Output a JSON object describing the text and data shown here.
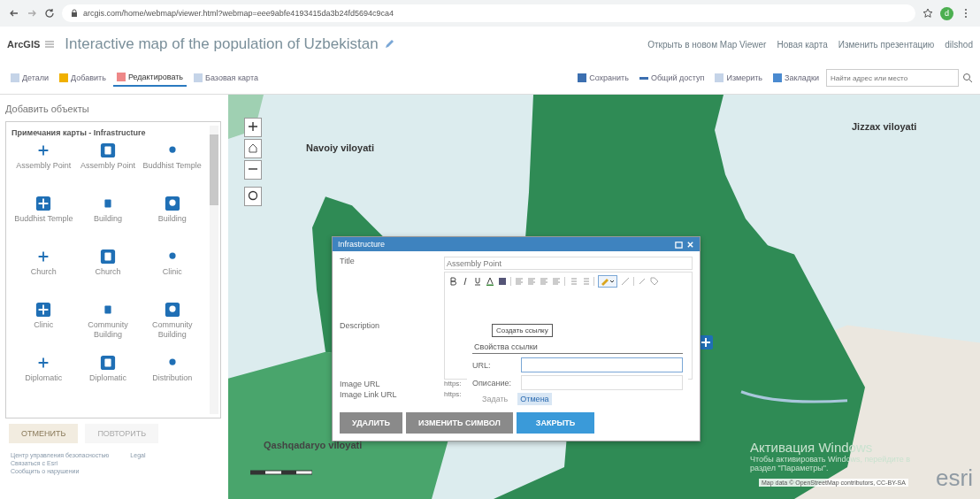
{
  "browser": {
    "url": "arcgis.com/home/webmap/viewer.html?webmap=eee9abfe4193415da3b24fd5694c9ca4",
    "avatar": "d"
  },
  "header": {
    "logo": "ArcGIS",
    "title": "Interactive map of the population of Uzbekistan",
    "links": [
      "Открыть в новом Map Viewer",
      "Новая карта",
      "Изменить презентацию"
    ],
    "user": "dilshod"
  },
  "toolbar": {
    "left": [
      {
        "label": "Детали",
        "selected": false
      },
      {
        "label": "Добавить",
        "selected": false
      },
      {
        "label": "Редактировать",
        "selected": true
      },
      {
        "label": "Базовая карта",
        "selected": false
      }
    ],
    "right": [
      "Сохранить",
      "Общий доступ",
      "Измерить",
      "Закладки"
    ],
    "search": {
      "placeholder": "Найти адрес или место"
    }
  },
  "panel": {
    "title": "Добавить объекты",
    "group": "Примечания карты - Infrastructure",
    "items": [
      {
        "label": "Assembly Point",
        "boxed": false
      },
      {
        "label": "Assembly Point",
        "boxed": true
      },
      {
        "label": "Buddhist Temple",
        "boxed": false
      },
      {
        "label": "Buddhist Temple",
        "boxed": true
      },
      {
        "label": "Building",
        "boxed": false
      },
      {
        "label": "Building",
        "boxed": true
      },
      {
        "label": "Church",
        "boxed": false
      },
      {
        "label": "Church",
        "boxed": true
      },
      {
        "label": "Clinic",
        "boxed": false
      },
      {
        "label": "Clinic",
        "boxed": true
      },
      {
        "label": "Community Building",
        "boxed": false
      },
      {
        "label": "Community Building",
        "boxed": true
      },
      {
        "label": "Diplomatic",
        "boxed": false
      },
      {
        "label": "Diplomatic",
        "boxed": true
      },
      {
        "label": "Distribution",
        "boxed": false
      }
    ],
    "undo": {
      "label": "ОТМЕНИТЬ",
      "disabled": false
    },
    "redo": {
      "label": "ПОВТОРИТЬ",
      "disabled": true
    },
    "footer": [
      "Центр управления безопасностью",
      "Legal",
      "Связаться с Esri",
      "Сообщить о нарушении"
    ]
  },
  "map": {
    "labels": [
      "Navoiy viloyati",
      "Jizzax viloyati",
      "Qashqadaryo viloyati"
    ],
    "attribution": "Map data © OpenStreetMap contributors, CC-BY-SA",
    "logo": "esri",
    "watermark": {
      "title": "Активация Windows",
      "text": "Чтобы активировать Windows, перейдите в раздел \"Параметры\"."
    }
  },
  "popup": {
    "title": "Infrastructure",
    "fields": [
      {
        "kind": "text",
        "label": "Title",
        "value": "Assembly Point"
      },
      {
        "kind": "editor",
        "label": "Description"
      },
      {
        "kind": "short",
        "label": "Image URL",
        "value": "https:"
      },
      {
        "kind": "short",
        "label": "Image Link URL",
        "value": "https:"
      }
    ],
    "tooltip": "Создать ссылку",
    "link_dialog": {
      "title": "Свойства ссылки",
      "url_label": "URL:",
      "desc_label": "Описание:",
      "buttons": [
        {
          "label": "Задать",
          "disabled": true
        },
        {
          "label": "Отмена",
          "disabled": false
        }
      ]
    },
    "buttons": [
      {
        "label": "УДАЛИТЬ",
        "kind": "grey"
      },
      {
        "label": "ИЗМЕНИТЬ СИМВОЛ",
        "kind": "grey"
      },
      {
        "label": "ЗАКРЫТЬ",
        "kind": "primary"
      }
    ]
  }
}
